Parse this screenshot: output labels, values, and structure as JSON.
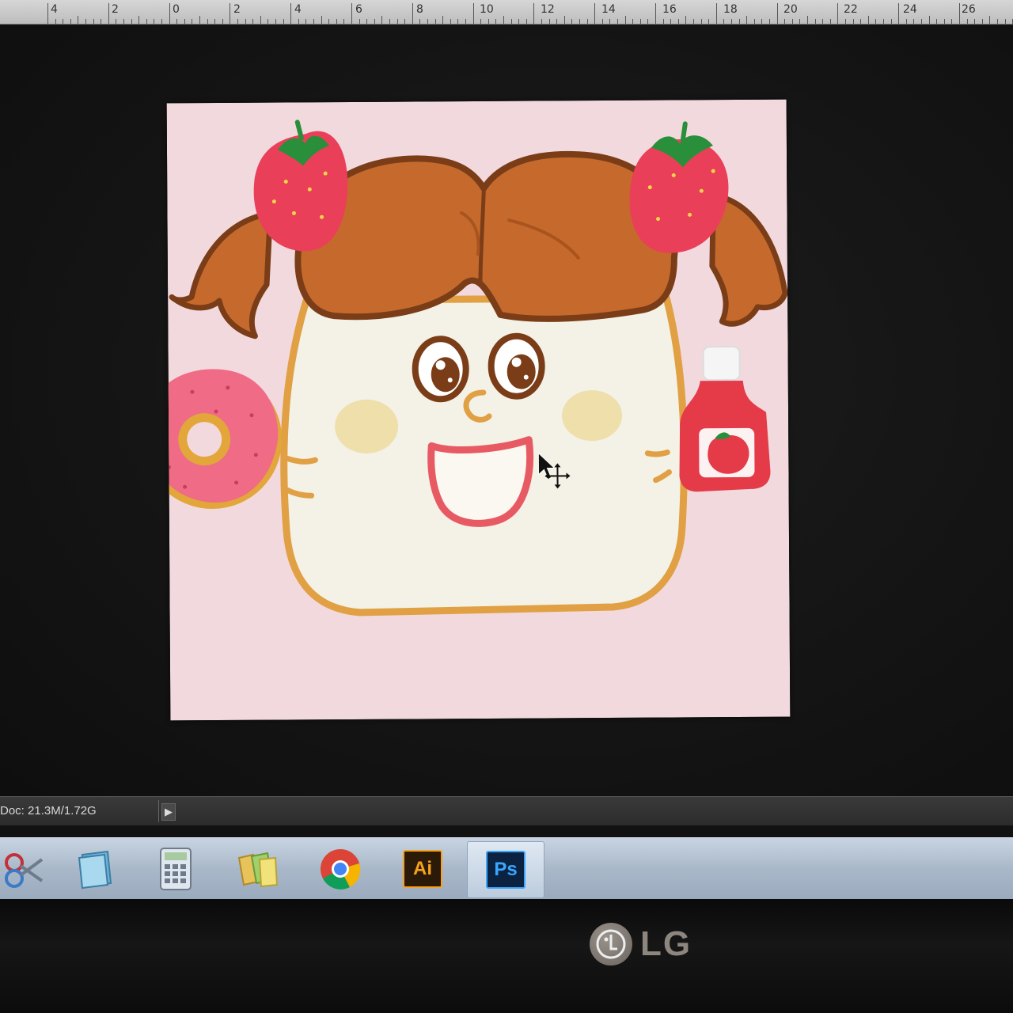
{
  "ruler": {
    "labels": [
      "4",
      "2",
      "0",
      "2",
      "4",
      "6",
      "8",
      "10",
      "12",
      "14",
      "16",
      "18",
      "20",
      "22",
      "24",
      "26"
    ]
  },
  "statusbar": {
    "doc_info": "Doc: 21.3M/1.72G",
    "menu_arrow_icon": "triangle-right-icon"
  },
  "taskbar": {
    "items": [
      {
        "name": "snipping-tool",
        "icon": "scissors-icon"
      },
      {
        "name": "sticky-notes",
        "icon": "note-pad-icon"
      },
      {
        "name": "calculator",
        "icon": "calculator-icon"
      },
      {
        "name": "windows-explorer",
        "icon": "folders-icon"
      },
      {
        "name": "google-chrome",
        "icon": "chrome-icon"
      },
      {
        "name": "adobe-illustrator",
        "icon_text": "Ai"
      },
      {
        "name": "adobe-photoshop",
        "icon_text": "Ps",
        "active": true
      }
    ]
  },
  "monitor": {
    "brand": "LG"
  },
  "colors": {
    "canvas_bg": "#f2d9de",
    "hair": "#c56a2c",
    "outline_brown": "#7a3d18",
    "bread_crust": "#e0a043",
    "bread_face": "#f4f1e6",
    "mouth_red": "#e85a63",
    "strawberry": "#ea3f58",
    "leaf": "#2a8f3a",
    "donut_frosting": "#ef6b86",
    "donut_dough": "#e3a63a"
  }
}
